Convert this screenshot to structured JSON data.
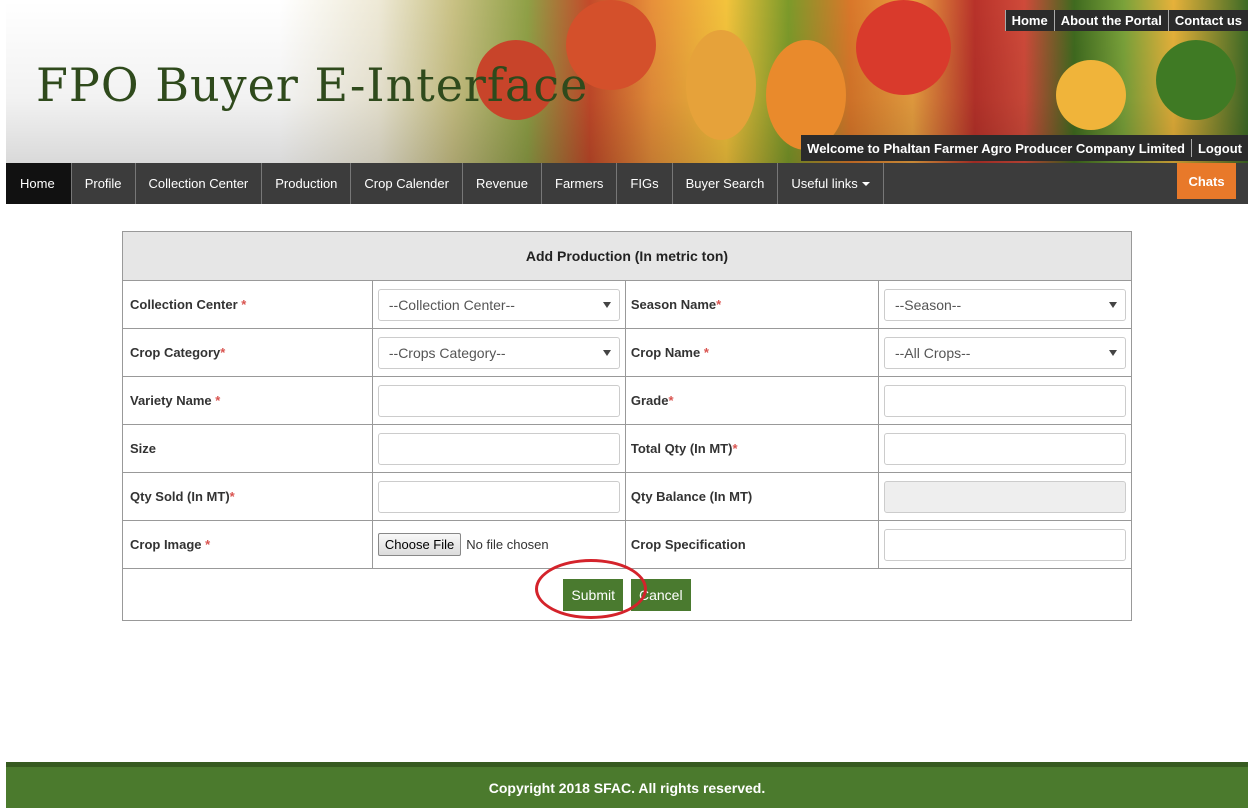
{
  "header": {
    "brand": "FPO Buyer E-Interface",
    "top_links": [
      "Home",
      "About the Portal",
      "Contact us"
    ],
    "welcome": "Welcome to Phaltan Farmer Agro Producer Company Limited",
    "logout": "Logout"
  },
  "nav": {
    "items": [
      "Home",
      "Profile",
      "Collection Center",
      "Production",
      "Crop Calender",
      "Revenue",
      "Farmers",
      "FIGs",
      "Buyer Search",
      "Useful links"
    ],
    "chats": "Chats"
  },
  "form": {
    "title": "Add Production (In metric ton)",
    "required_mark": "*",
    "collection_center": {
      "label": "Collection Center",
      "value": "--Collection Center--"
    },
    "season": {
      "label": "Season Name",
      "value": "--Season--"
    },
    "crop_category": {
      "label": "Crop Category",
      "value": "--Crops Category--"
    },
    "crop_name": {
      "label": "Crop Name",
      "value": "--All Crops--"
    },
    "variety": {
      "label": "Variety Name"
    },
    "grade": {
      "label": "Grade"
    },
    "size": {
      "label": "Size"
    },
    "total_qty": {
      "label": "Total Qty (In MT)"
    },
    "qty_sold": {
      "label": "Qty Sold (In MT)"
    },
    "qty_balance": {
      "label": "Qty Balance (In MT)"
    },
    "crop_image": {
      "label": "Crop Image",
      "button": "Choose File",
      "status": "No file chosen"
    },
    "crop_spec": {
      "label": "Crop Specification"
    },
    "submit": "Submit",
    "cancel": "Cancel"
  },
  "footer": {
    "text": "Copyright 2018 SFAC. All rights reserved."
  },
  "colors": {
    "accent_green": "#4a7a2f",
    "chats_orange": "#e8792a",
    "nav_dark": "#3c3c3c",
    "highlight_circle": "#d4232b"
  }
}
